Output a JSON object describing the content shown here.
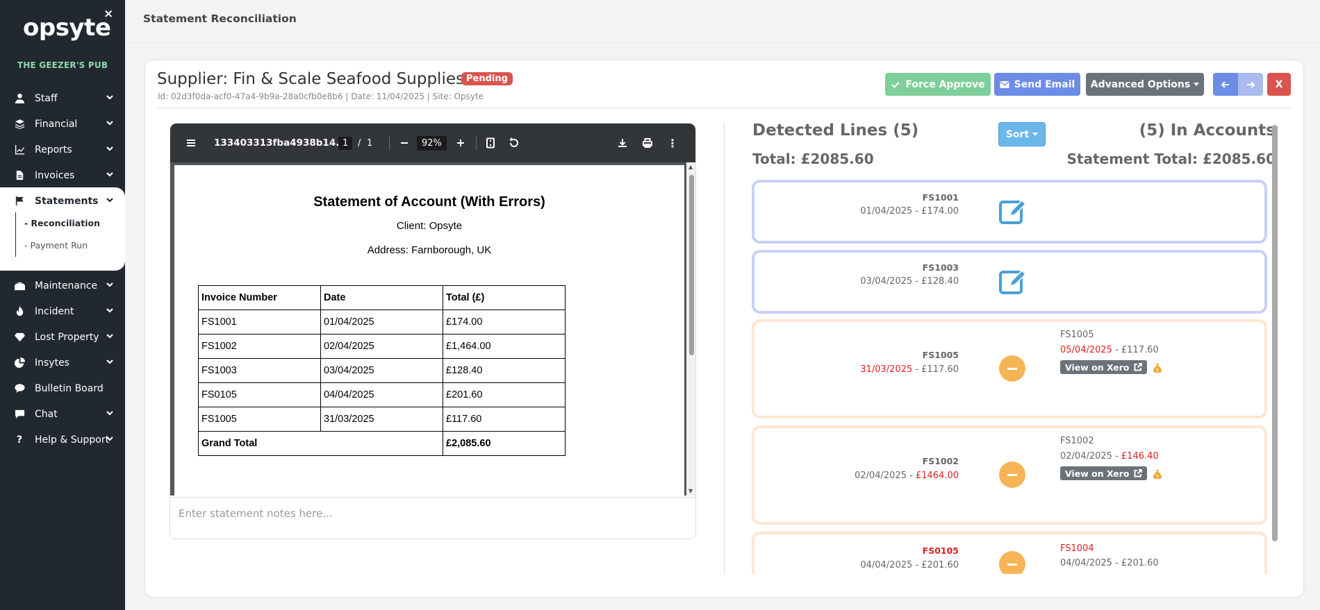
{
  "app": {
    "logo": "opsyte",
    "venue": "THE GEEZER'S PUB",
    "close": "×"
  },
  "sidebar": {
    "items": [
      {
        "label": "Staff",
        "icon": "user-icon",
        "chevron": true
      },
      {
        "label": "Financial",
        "icon": "layers-icon",
        "chevron": true
      },
      {
        "label": "Reports",
        "icon": "chart-line-icon",
        "chevron": true
      },
      {
        "label": "Invoices",
        "icon": "file-icon",
        "chevron": true
      },
      {
        "label": "Statements",
        "icon": "flag-icon",
        "chevron": true,
        "active": true
      },
      {
        "label": "Maintenance",
        "icon": "toolbox-icon",
        "chevron": true
      },
      {
        "label": "Incident",
        "icon": "fire-icon",
        "chevron": true
      },
      {
        "label": "Lost Property",
        "icon": "gem-icon",
        "chevron": true
      },
      {
        "label": "Insytes",
        "icon": "pie-chart-icon",
        "chevron": true
      },
      {
        "label": "Bulletin Board",
        "icon": "comment-icon",
        "chevron": false
      },
      {
        "label": "Chat",
        "icon": "chat-icon",
        "chevron": true
      },
      {
        "label": "Help & Support",
        "icon": "question-icon",
        "chevron": true
      }
    ],
    "sub_items": [
      {
        "label": "- Reconciliation",
        "active": true
      },
      {
        "label": "- Payment Run",
        "active": false
      }
    ]
  },
  "header": {
    "title": "Statement Reconciliation"
  },
  "statement": {
    "supplier_title": "Supplier: Fin & Scale Seafood Supplies",
    "status": "Pending",
    "meta": "Id: 02d3f0da-acf0-47a4-9b9a-28a0cfb0e8b6 | Date: 11/04/2025 | Site: Opsyte"
  },
  "actions": {
    "force_approve": "Force Approve",
    "send_email": "Send Email",
    "advanced_options": "Advanced Options",
    "close": "X"
  },
  "pdf": {
    "filename": "133403313fba4938b14...",
    "page_current": "1",
    "page_sep": "/",
    "page_total": "1",
    "zoom": "92%",
    "doc_title": "Statement of Account (With Errors)",
    "client": "Client: Opsyte",
    "address": "Address: Farnborough, UK",
    "columns": [
      "Invoice Number",
      "Date",
      "Total (£)"
    ],
    "rows": [
      [
        "FS1001",
        "01/04/2025",
        "£174.00"
      ],
      [
        "FS1002",
        "02/04/2025",
        "£1,464.00"
      ],
      [
        "FS1003",
        "03/04/2025",
        "£128.40"
      ],
      [
        "FS0105",
        "04/04/2025",
        "£201.60"
      ],
      [
        "FS1005",
        "31/03/2025",
        "£117.60"
      ]
    ],
    "grand_total_label": "Grand Total",
    "grand_total_value": "£2,085.60"
  },
  "notes": {
    "placeholder": "Enter statement notes here..."
  },
  "summary": {
    "detected_lines": "Detected Lines (5)",
    "in_accounts": "(5) In Accounts",
    "total": "Total: £2085.60",
    "statement_total": "Statement Total: £2085.60",
    "sort": "Sort"
  },
  "lines": [
    {
      "invoice": "FS1001",
      "date": "01/04/2025",
      "sep": " - ",
      "amount": "£174.00",
      "status": "matched"
    },
    {
      "invoice": "FS1003",
      "date": "03/04/2025",
      "sep": " - ",
      "amount": "£128.40",
      "status": "matched"
    },
    {
      "invoice": "FS1005",
      "date": "31/03/2025",
      "sep": " - ",
      "amount": "£117.60",
      "status": "mismatch",
      "acc_invoice": "FS1005",
      "acc_date": "05/04/2025",
      "acc_sep": " - ",
      "acc_amount": "£117.60",
      "xero": "View on Xero"
    },
    {
      "invoice": "FS1002",
      "date": "02/04/2025",
      "sep": " - ",
      "amount": "£1464.00",
      "status": "mismatch",
      "acc_invoice": "FS1002",
      "acc_date": "02/04/2025",
      "acc_sep": " - ",
      "acc_amount": "£146.40",
      "xero": "View on Xero"
    },
    {
      "invoice": "FS0105",
      "date": "04/04/2025",
      "sep": " - ",
      "amount": "£201.60",
      "status": "mismatch",
      "acc_invoice": "FS1004",
      "acc_date": "04/04/2025",
      "acc_sep": " - ",
      "acc_amount": "£201.60"
    }
  ],
  "colors": {
    "sidebar": "#212830",
    "venue": "#8fd9a8",
    "approve": "#7fcf9c",
    "email": "#6d8ce6",
    "danger": "#d9534f",
    "warning": "#f5b455",
    "matched_border": "#c9cff5",
    "mismatch_border": "#fde7d2"
  }
}
